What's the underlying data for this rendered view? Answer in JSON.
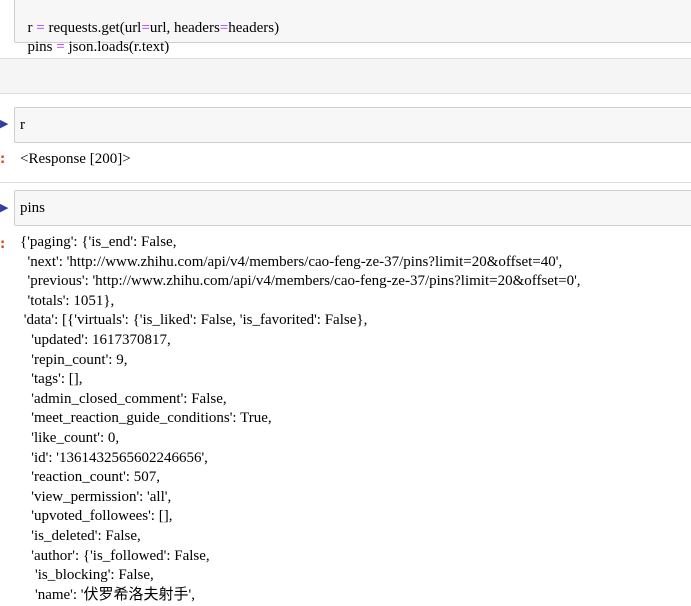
{
  "cell1": {
    "line1_parts": [
      "r ",
      "=",
      " requests.get(url",
      "=",
      "url, headers",
      "=",
      "headers)"
    ],
    "line2_parts": [
      "pins ",
      "=",
      " json.loads(r.text)"
    ]
  },
  "cell2": {
    "in_marker": "▶",
    "code": "r",
    "out_marker": ":",
    "output": "<Response [200]>"
  },
  "cell3": {
    "in_marker": "▶",
    "code": "pins",
    "out_marker": ":",
    "output_lines": [
      "{'paging': {'is_end': False,",
      "  'next': 'http://www.zhihu.com/api/v4/members/cao-feng-ze-37/pins?limit=20&offset=40',",
      "  'previous': 'http://www.zhihu.com/api/v4/members/cao-feng-ze-37/pins?limit=20&offset=0',",
      "  'totals': 1051},",
      " 'data': [{'virtuals': {'is_liked': False, 'is_favorited': False},",
      "   'updated': 1617370817,",
      "   'repin_count': 9,",
      "   'tags': [],",
      "   'admin_closed_comment': False,",
      "   'meet_reaction_guide_conditions': True,",
      "   'like_count': 0,",
      "   'id': '1361432565602246656',",
      "   'reaction_count': 507,",
      "   'view_permission': 'all',",
      "   'upvoted_followees': [],",
      "   'is_deleted': False,",
      "   'author': {'is_followed': False,",
      "    'is_blocking': False,",
      "    'name': '伏罗希洛夫射手',"
    ]
  },
  "colors": {
    "input_bg": "#f7f7f7",
    "operator": "#aa22ff",
    "out_prompt": "#d84315",
    "in_prompt": "#303f9f"
  }
}
